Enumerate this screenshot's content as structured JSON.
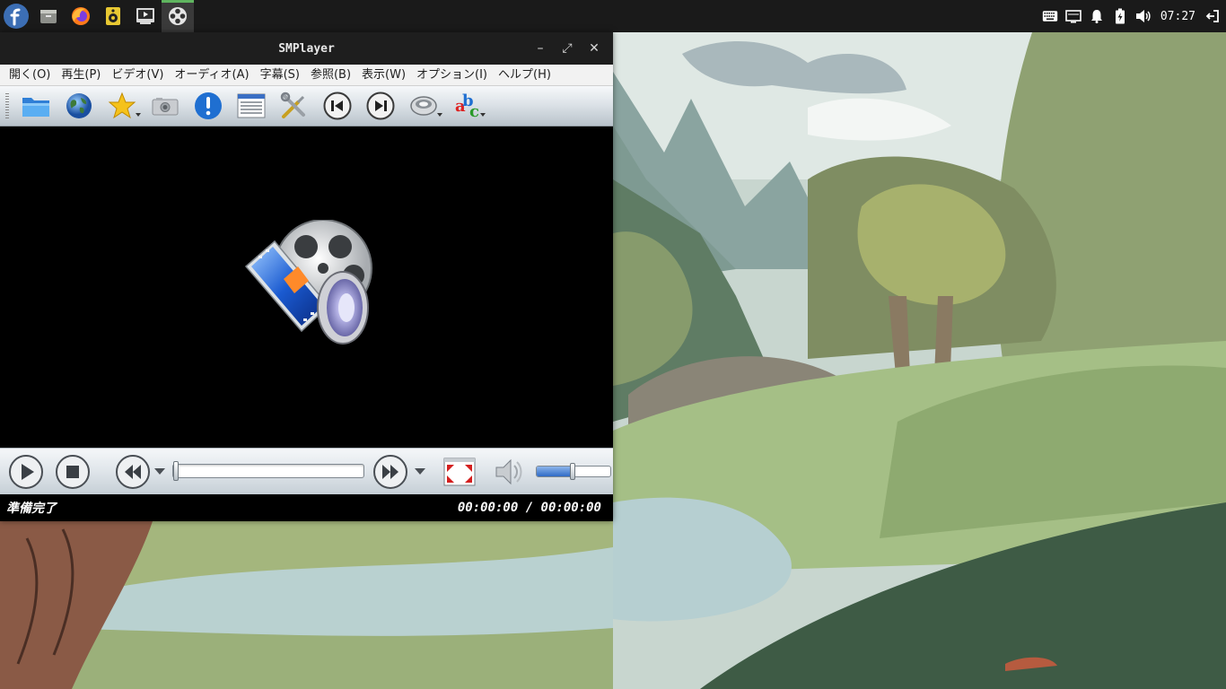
{
  "taskbar": {
    "launchers": [
      {
        "name": "fedora-icon"
      },
      {
        "name": "file-manager-icon"
      },
      {
        "name": "firefox-icon"
      },
      {
        "name": "audio-player-icon"
      },
      {
        "name": "video-app-icon"
      },
      {
        "name": "smplayer-icon",
        "active": true
      }
    ],
    "clock": "07:27",
    "accent_color": "#5fb55f"
  },
  "window": {
    "title": "SMPlayer",
    "controls": {
      "minimize": "–",
      "maximize": "⤢",
      "close": "✕"
    }
  },
  "menubar": {
    "items": [
      {
        "id": "open",
        "label": "開く(O)"
      },
      {
        "id": "play",
        "label": "再生(P)"
      },
      {
        "id": "video",
        "label": "ビデオ(V)"
      },
      {
        "id": "audio",
        "label": "オーディオ(A)"
      },
      {
        "id": "subtitles",
        "label": "字幕(S)"
      },
      {
        "id": "browse",
        "label": "参照(B)"
      },
      {
        "id": "view",
        "label": "表示(W)"
      },
      {
        "id": "options",
        "label": "オプション(I)"
      },
      {
        "id": "help",
        "label": "ヘルプ(H)"
      }
    ]
  },
  "toolbar": {
    "buttons": [
      {
        "name": "open-folder-icon"
      },
      {
        "name": "globe-icon"
      },
      {
        "name": "favorites-star-icon",
        "dropdown": true
      },
      {
        "name": "screenshot-camera-icon"
      },
      {
        "name": "info-icon"
      },
      {
        "name": "playlist-icon"
      },
      {
        "name": "preferences-tools-icon"
      },
      {
        "name": "previous-track-icon"
      },
      {
        "name": "next-track-icon"
      },
      {
        "name": "audio-track-icon",
        "dropdown": true
      },
      {
        "name": "subtitle-track-icon",
        "dropdown": true
      }
    ]
  },
  "controls": {
    "seek_position": 0,
    "volume": 0.5,
    "volume_color": "#2f6bc6"
  },
  "status": {
    "message": "準備完了",
    "time": "00:00:00 / 00:00:00"
  }
}
